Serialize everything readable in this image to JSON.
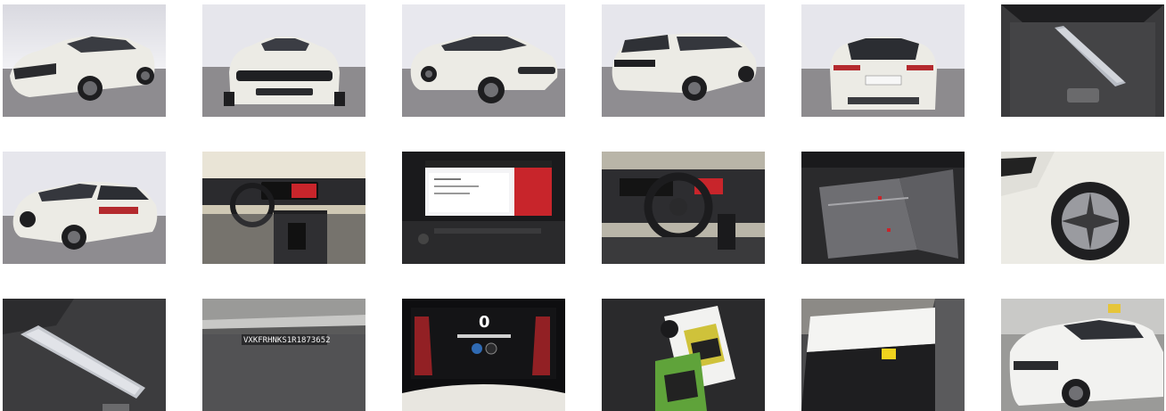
{
  "gallery": {
    "photos": [
      {
        "subject": "front-left-three-quarter-exterior"
      },
      {
        "subject": "front-exterior"
      },
      {
        "subject": "left-side-exterior"
      },
      {
        "subject": "rear-right-three-quarter-exterior"
      },
      {
        "subject": "rear-exterior"
      },
      {
        "subject": "trunk-interior"
      },
      {
        "subject": "rear-left-three-quarter-exterior"
      },
      {
        "subject": "cockpit-dashboard"
      },
      {
        "subject": "infotainment-touchscreen"
      },
      {
        "subject": "steering-wheel-and-instruments"
      },
      {
        "subject": "rear-seats"
      },
      {
        "subject": "front-wheel-closeup"
      },
      {
        "subject": "trunk-floor-with-tools"
      },
      {
        "subject": "vin-plate"
      },
      {
        "subject": "digital-instrument-cluster"
      },
      {
        "subject": "documents-on-seat"
      },
      {
        "subject": "roof-and-windshield"
      },
      {
        "subject": "front-exterior-in-workshop"
      }
    ],
    "vin_text": "VXKFRHNKS1R1873652",
    "cluster_digit": "0"
  },
  "colors": {
    "car_white": "#ecebe5",
    "studio_wall": "#eeeef2",
    "studio_floor": "#8d8b8e",
    "interior_dark": "#2e2e30",
    "screen_red": "#c8252b"
  }
}
